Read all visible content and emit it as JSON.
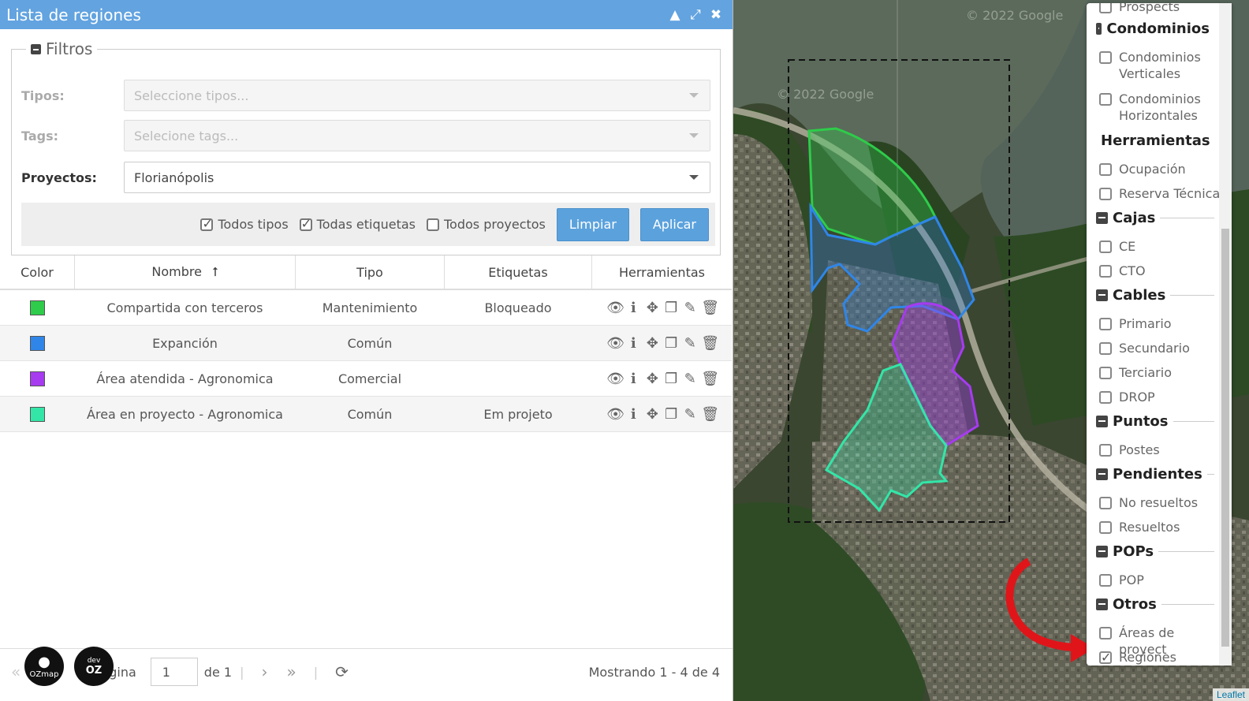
{
  "panel": {
    "title": "Lista de regiones",
    "filters": {
      "legend": "Filtros",
      "tipos_label": "Tipos:",
      "tipos_placeholder": "Seleccione tipos...",
      "tags_label": "Tags:",
      "tags_placeholder": "Selecione tags...",
      "proyectos_label": "Proyectos:",
      "proyectos_value": "Florianópolis",
      "todos_tipos": "Todos tipos",
      "todas_etiquetas": "Todas etiquetas",
      "todos_proyectos": "Todos proyectos",
      "limpiar": "Limpiar",
      "aplicar": "Aplicar"
    },
    "table": {
      "headers": [
        "Color",
        "Nombre",
        "Tipo",
        "Etiquetas",
        "Herramientas"
      ],
      "rows": [
        {
          "color": "#2ecc4a",
          "nombre": "Compartida con terceros",
          "tipo": "Mantenimiento",
          "etiquetas": "Bloqueado"
        },
        {
          "color": "#2f86e8",
          "nombre": "Expanción",
          "tipo": "Común",
          "etiquetas": ""
        },
        {
          "color": "#a63bf0",
          "nombre": "Área atendida - Agronomica",
          "tipo": "Comercial",
          "etiquetas": ""
        },
        {
          "color": "#33e6a8",
          "nombre": "Área en proyecto - Agronomica",
          "tipo": "Común",
          "etiquetas": "Em projeto"
        }
      ]
    },
    "pager": {
      "page_label": "gina",
      "page_value": "1",
      "of_label": "de 1",
      "showing": "Mostrando 1 - 4 de 4"
    },
    "logos": {
      "ozmap": "OZmap",
      "devoz_top": "dev",
      "devoz_bottom": "OZ"
    }
  },
  "map": {
    "watermark1": "© 2022 Google",
    "watermark2": "© 2022 Google",
    "attribution": "Leaflet"
  },
  "layers": {
    "top_item": "Prospects",
    "groups": [
      {
        "name": "Condominios",
        "items": [
          "Condominios Verticales",
          "Condominios Horizontales"
        ]
      },
      {
        "name": "Herramientas",
        "items": [
          "Ocupación",
          "Reserva Técnica"
        ]
      },
      {
        "name": "Cajas",
        "items": [
          "CE",
          "CTO"
        ]
      },
      {
        "name": "Cables",
        "items": [
          "Primario",
          "Secundario",
          "Terciario",
          "DROP"
        ]
      },
      {
        "name": "Puntos",
        "items": [
          "Postes"
        ]
      },
      {
        "name": "Pendientes",
        "items": [
          "No resueltos",
          "Resueltos"
        ]
      },
      {
        "name": "POPs",
        "items": [
          "POP"
        ]
      },
      {
        "name": "Otros",
        "items": [
          "Áreas de proyect",
          "Regiones"
        ]
      }
    ]
  }
}
